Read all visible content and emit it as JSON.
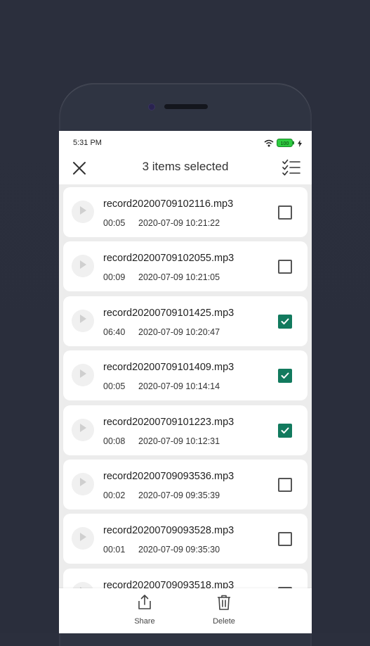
{
  "status_bar": {
    "time": "5:31 PM",
    "battery": "100"
  },
  "app_bar": {
    "title": "3 items selected"
  },
  "recordings": [
    {
      "filename": "record20200709102116.mp3",
      "duration": "00:05",
      "datetime": "2020-07-09 10:21:22",
      "checked": false
    },
    {
      "filename": "record20200709102055.mp3",
      "duration": "00:09",
      "datetime": "2020-07-09 10:21:05",
      "checked": false
    },
    {
      "filename": "record20200709101425.mp3",
      "duration": "06:40",
      "datetime": "2020-07-09 10:20:47",
      "checked": true
    },
    {
      "filename": "record20200709101409.mp3",
      "duration": "00:05",
      "datetime": "2020-07-09 10:14:14",
      "checked": true
    },
    {
      "filename": "record20200709101223.mp3",
      "duration": "00:08",
      "datetime": "2020-07-09 10:12:31",
      "checked": true
    },
    {
      "filename": "record20200709093536.mp3",
      "duration": "00:02",
      "datetime": "2020-07-09 09:35:39",
      "checked": false
    },
    {
      "filename": "record20200709093528.mp3",
      "duration": "00:01",
      "datetime": "2020-07-09 09:35:30",
      "checked": false
    },
    {
      "filename": "record20200709093518.mp3",
      "duration": "",
      "datetime": "",
      "checked": false
    }
  ],
  "bottom_bar": {
    "share_label": "Share",
    "delete_label": "Delete"
  },
  "icons": {
    "close": "close-icon",
    "select_all": "checklist-icon",
    "play": "play-icon",
    "share": "share-icon",
    "delete": "trash-icon",
    "wifi": "wifi-icon",
    "battery": "battery-icon",
    "charging": "lightning-icon"
  },
  "colors": {
    "accent": "#127a5e",
    "battery_green": "#2ecc40",
    "background": "#2b2f3d",
    "list_background": "#ececec"
  }
}
